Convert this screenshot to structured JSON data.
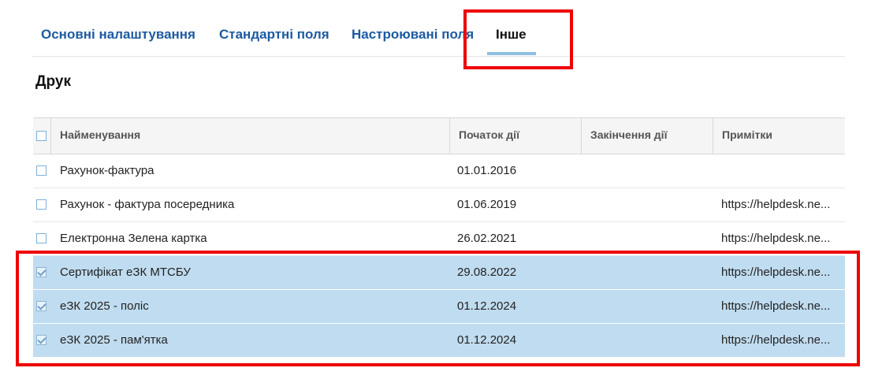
{
  "tabs": [
    {
      "label": "Основні налаштування"
    },
    {
      "label": "Стандартні поля"
    },
    {
      "label": "Настроювані поля"
    },
    {
      "label": "Інше"
    }
  ],
  "section": {
    "title": "Друк"
  },
  "table": {
    "columns": [
      "Найменування",
      "Початок дії",
      "Закінчення дії",
      "Примітки"
    ],
    "rows": [
      {
        "name": "Рахунок-фактура",
        "start": "01.01.2016",
        "end": "",
        "notes": "",
        "checked": false
      },
      {
        "name": "Рахунок - фактура посередника",
        "start": "01.06.2019",
        "end": "",
        "notes": "https://helpdesk.ne...",
        "checked": false
      },
      {
        "name": "Електронна Зелена картка",
        "start": "26.02.2021",
        "end": "",
        "notes": "https://helpdesk.ne...",
        "checked": false
      },
      {
        "name": "Сертифікат еЗК МТСБУ",
        "start": "29.08.2022",
        "end": "",
        "notes": "https://helpdesk.ne...",
        "checked": true
      },
      {
        "name": "еЗК 2025 - поліс",
        "start": "01.12.2024",
        "end": "",
        "notes": "https://helpdesk.ne...",
        "checked": true
      },
      {
        "name": "еЗК 2025 - пам'ятка",
        "start": "01.12.2024",
        "end": "",
        "notes": "https://helpdesk.ne...",
        "checked": true
      }
    ]
  },
  "colors": {
    "highlight": "#ee0000",
    "selected_row": "#c0dcf0",
    "tab_link": "#1d5aa0"
  }
}
